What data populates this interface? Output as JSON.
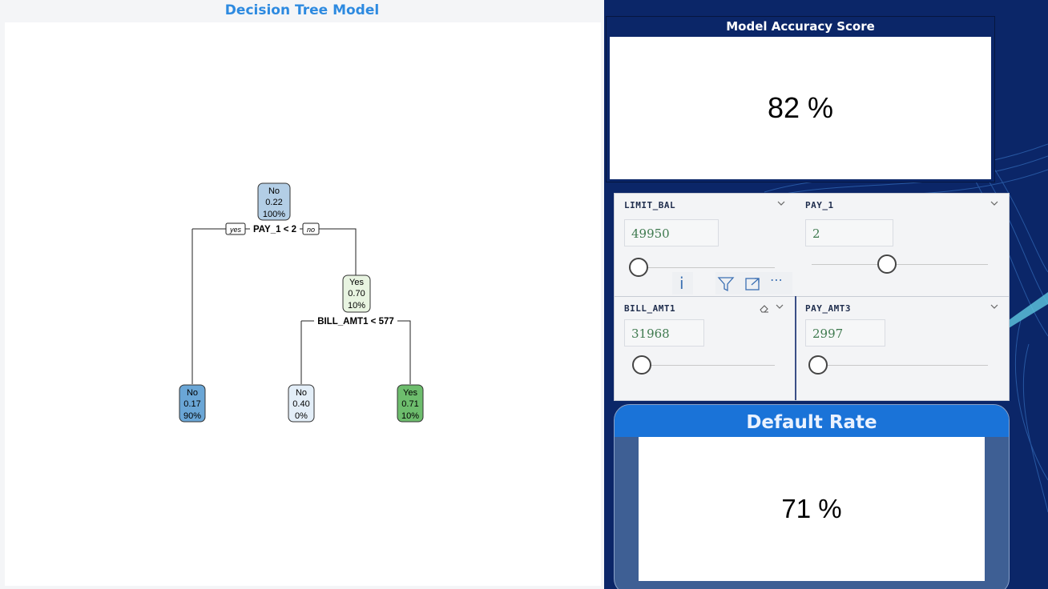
{
  "left": {
    "title": "Decision Tree Model"
  },
  "tree": {
    "root": {
      "label": "No",
      "prob": "0.22",
      "pct": "100%"
    },
    "split1": {
      "condition": "PAY_1 < 2",
      "yes": "yes",
      "no": "no"
    },
    "node_right": {
      "label": "Yes",
      "prob": "0.70",
      "pct": "10%"
    },
    "split2": {
      "condition": "BILL_AMT1 < 577"
    },
    "leaf1": {
      "label": "No",
      "prob": "0.17",
      "pct": "90%"
    },
    "leaf2": {
      "label": "No",
      "prob": "0.40",
      "pct": "0%"
    },
    "leaf3": {
      "label": "Yes",
      "prob": "0.71",
      "pct": "10%"
    },
    "colors": {
      "root": "#b3cee6",
      "node_right": "#e8f4e1",
      "leaf1": "#6aa6d6",
      "leaf2": "#e3eef8",
      "leaf3": "#6dbd6d"
    }
  },
  "accuracy": {
    "title": "Model Accuracy Score",
    "value": "82 %"
  },
  "slicers": {
    "limit_bal": {
      "label": "LIMIT_BAL",
      "value": "49950"
    },
    "pay_1": {
      "label": "PAY_1",
      "value": "2"
    },
    "bill_amt1": {
      "label": "BILL_AMT1",
      "value": "31968"
    },
    "pay_amt3": {
      "label": "PAY_AMT3",
      "value": "2997"
    }
  },
  "toolbar": {
    "info_icon": "info-icon",
    "filter_icon": "filter-icon",
    "focus_icon": "focus-mode-icon",
    "more_icon": "more-options-icon"
  },
  "default_rate": {
    "title": "Default Rate",
    "value": "71 %"
  }
}
